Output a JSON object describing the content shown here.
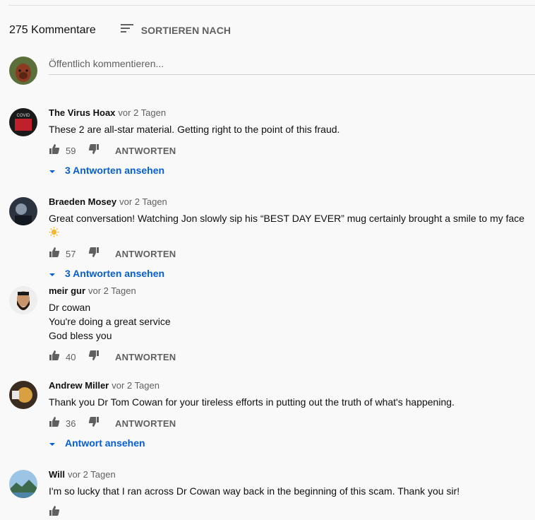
{
  "header": {
    "count": "275 Kommentare",
    "sort_label": "SORTIEREN NACH"
  },
  "new_comment": {
    "placeholder": "Öffentlich kommentieren..."
  },
  "comments": [
    {
      "author": "The Virus Hoax",
      "time": "vor 2 Tagen",
      "text": "These 2 are all-star material. Getting right to the point of this fraud.",
      "likes": "59",
      "reply": "ANTWORTEN",
      "replies": "3 Antworten ansehen",
      "avatar_colors": [
        "#1a1a1a",
        "#c0202a"
      ]
    },
    {
      "author": "Braeden Mosey",
      "time": "vor 2 Tagen",
      "text": "Great conversation! Watching Jon slowly sip his “BEST DAY EVER” mug certainly brought a smile to my face",
      "likes": "57",
      "reply": "ANTWORTEN",
      "replies": "3 Antworten ansehen",
      "avatar_colors": [
        "#2b3340",
        "#8a96a8"
      ]
    },
    {
      "author": "meir gur",
      "time": "vor 2 Tagen",
      "text": "Dr cowan\n You're doing a great service\nGod bless you",
      "likes": "40",
      "reply": "ANTWORTEN",
      "avatar_colors": [
        "#e8e8e8",
        "#5a3a28"
      ]
    },
    {
      "author": "Andrew Miller",
      "time": "vor 2 Tagen",
      "text": "Thank you Dr Tom Cowan for your tireless efforts in putting out the truth of what's happening.",
      "likes": "36",
      "reply": "ANTWORTEN",
      "replies": "Antwort ansehen",
      "avatar_colors": [
        "#3a2c20",
        "#d8a040"
      ]
    },
    {
      "author": "Will",
      "time": "vor 2 Tagen",
      "text": "I'm so lucky that I ran across Dr Cowan way back in the beginning of this scam.  Thank you sir!",
      "likes": "",
      "reply": "",
      "avatar_colors": [
        "#7fb0d8",
        "#3d6a4a"
      ]
    }
  ],
  "colors": {
    "link": "#065fd4",
    "secondary": "#606060",
    "background": "#f9f9f9"
  }
}
